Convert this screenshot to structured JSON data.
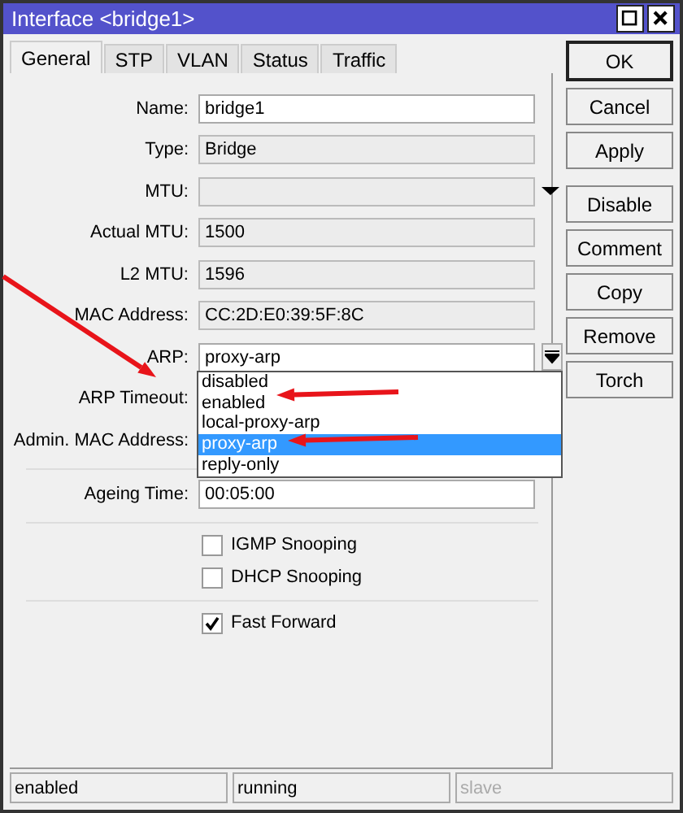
{
  "window": {
    "title": "Interface <bridge1>"
  },
  "tabs": [
    {
      "label": "General",
      "selected": true
    },
    {
      "label": "STP",
      "selected": false
    },
    {
      "label": "VLAN",
      "selected": false
    },
    {
      "label": "Status",
      "selected": false
    },
    {
      "label": "Traffic",
      "selected": false
    }
  ],
  "sections": [
    {
      "rows": [
        {
          "kind": "text",
          "label": "Name:",
          "value": "bridge1",
          "disabled": false
        },
        {
          "kind": "text",
          "label": "Type:",
          "value": "Bridge",
          "disabled": true
        },
        {
          "kind": "combo",
          "label": "MTU:",
          "disabled": true
        },
        {
          "kind": "text",
          "label": "Actual MTU:",
          "value": "1500",
          "disabled": true
        },
        {
          "kind": "text",
          "label": "L2 MTU:",
          "value": "1596",
          "disabled": true
        },
        {
          "kind": "text",
          "label": "MAC Address:",
          "value": "CC:2D:E0:39:5F:8C",
          "disabled": true
        },
        {
          "kind": "select",
          "label": "ARP:",
          "value": "proxy-arp",
          "expanded": true,
          "options": [
            {
              "label": "disabled",
              "selected": false
            },
            {
              "label": "enabled",
              "selected": false
            },
            {
              "label": "local-proxy-arp",
              "selected": false
            },
            {
              "label": "proxy-arp",
              "selected": true
            },
            {
              "label": "reply-only",
              "selected": false
            }
          ]
        },
        {
          "kind": "covered",
          "label": "ARP Timeout:"
        },
        {
          "kind": "covered",
          "label": "Admin. MAC Address:"
        }
      ]
    },
    {
      "rows": [
        {
          "kind": "text",
          "label": "Ageing Time:",
          "value": "00:05:00",
          "disabled": false
        }
      ]
    },
    {
      "rows": [
        {
          "kind": "checkbox",
          "label": "IGMP Snooping",
          "checked": false
        },
        {
          "kind": "checkbox",
          "label": "DHCP Snooping",
          "checked": false
        }
      ]
    },
    {
      "rows": [
        {
          "kind": "checkbox",
          "label": "Fast Forward",
          "checked": true
        }
      ]
    }
  ],
  "button_groups": [
    {
      "buttons": [
        {
          "label": "OK",
          "default": true
        },
        {
          "label": "Cancel",
          "default": false
        },
        {
          "label": "Apply",
          "default": false
        }
      ]
    },
    {
      "buttons": [
        {
          "label": "Disable",
          "default": false
        },
        {
          "label": "Comment",
          "default": false
        },
        {
          "label": "Copy",
          "default": false
        },
        {
          "label": "Remove",
          "default": false
        },
        {
          "label": "Torch",
          "default": false
        }
      ]
    }
  ],
  "status_bar": [
    {
      "text": "enabled",
      "disabled": false
    },
    {
      "text": "running",
      "disabled": false
    },
    {
      "text": "slave",
      "disabled": true
    }
  ]
}
